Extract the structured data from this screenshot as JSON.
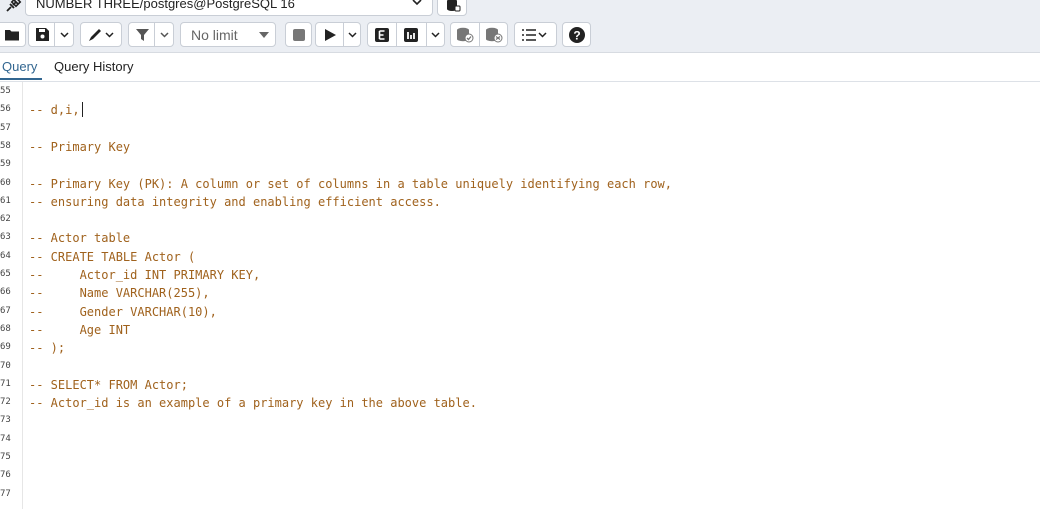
{
  "connection": {
    "label": "NUMBER THREE/postgres@PostgreSQL 16",
    "left_icon": "plug-disconnected-icon",
    "chevron_icon": "chevron-down-icon",
    "db_icon": "database-stack-icon"
  },
  "toolbar": {
    "open_icon": "folder-open-icon",
    "save_icon": "save-icon",
    "save_menu_icon": "chevron-down-icon",
    "edit_icon": "pencil-icon",
    "filter_icon": "filter-icon",
    "filter_menu_icon": "chevron-down-icon",
    "limit_value": "No limit",
    "stop_icon": "stop-icon",
    "execute_icon": "play-icon",
    "execute_menu_icon": "chevron-down-icon",
    "explain_icon": "explain-e-icon",
    "explain_analyze_icon": "explain-analyze-icon",
    "explain_menu_icon": "chevron-down-icon",
    "commit_icon": "commit-db-icon",
    "rollback_icon": "rollback-db-icon",
    "macros_icon": "list-icon",
    "help_icon": "help-icon"
  },
  "tabs": {
    "query": "Query",
    "history": "Query History"
  },
  "editor": {
    "lines": [
      {
        "no": "55",
        "text": ""
      },
      {
        "no": "56",
        "text": "-- d,i,"
      },
      {
        "no": "57",
        "text": ""
      },
      {
        "no": "58",
        "text": "-- Primary Key"
      },
      {
        "no": "59",
        "text": ""
      },
      {
        "no": "60",
        "text": "-- Primary Key (PK): A column or set of columns in a table uniquely identifying each row,"
      },
      {
        "no": "61",
        "text": "-- ensuring data integrity and enabling efficient access."
      },
      {
        "no": "62",
        "text": ""
      },
      {
        "no": "63",
        "text": "-- Actor table"
      },
      {
        "no": "64",
        "text": "-- CREATE TABLE Actor ("
      },
      {
        "no": "65",
        "text": "--     Actor_id INT PRIMARY KEY,"
      },
      {
        "no": "66",
        "text": "--     Name VARCHAR(255),"
      },
      {
        "no": "67",
        "text": "--     Gender VARCHAR(10),"
      },
      {
        "no": "68",
        "text": "--     Age INT"
      },
      {
        "no": "69",
        "text": "-- );"
      },
      {
        "no": "70",
        "text": ""
      },
      {
        "no": "71",
        "text": "-- SELECT* FROM Actor;"
      },
      {
        "no": "72",
        "text": "-- Actor_id is an example of a primary key in the above table."
      },
      {
        "no": "73",
        "text": ""
      },
      {
        "no": "74",
        "text": ""
      },
      {
        "no": "75",
        "text": ""
      },
      {
        "no": "76",
        "text": ""
      },
      {
        "no": "77",
        "text": ""
      }
    ]
  }
}
